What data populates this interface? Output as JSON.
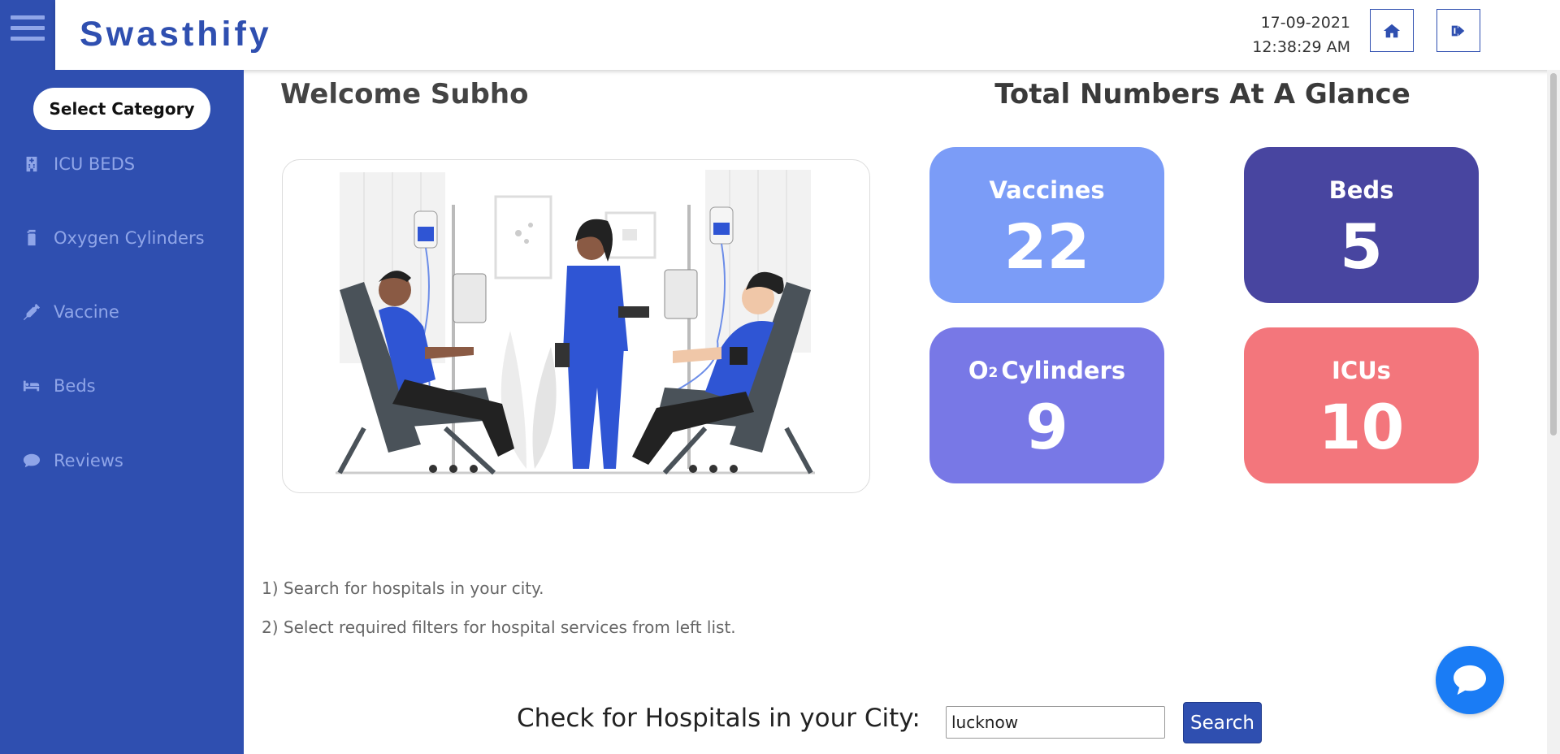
{
  "header": {
    "brand": "Swasthify",
    "date": "17-09-2021",
    "time": "12:38:29 AM",
    "home_icon": "home-icon",
    "logout_icon": "sign-out-icon"
  },
  "sidebar": {
    "category_button": "Select Category",
    "items": [
      {
        "label": "ICU BEDS",
        "icon": "hospital-building-icon"
      },
      {
        "label": "Oxygen Cylinders",
        "icon": "oxygen-cylinder-icon"
      },
      {
        "label": "Vaccine",
        "icon": "syringe-icon"
      },
      {
        "label": "Beds",
        "icon": "bed-icon"
      },
      {
        "label": "Reviews",
        "icon": "comment-icon"
      }
    ]
  },
  "main": {
    "welcome": "Welcome Subho",
    "glance_title": "Total Numbers At A Glance",
    "stats": [
      {
        "label": "Vaccines",
        "value": "22",
        "color": "#7b9cf7"
      },
      {
        "label": "Beds",
        "value": "5",
        "color": "#4845a0"
      },
      {
        "label_prefix": "O",
        "label_sub": "2",
        "label": "Cylinders",
        "value": "9",
        "color": "#7878e6"
      },
      {
        "label": "ICUs",
        "value": "10",
        "color": "#f3767c"
      }
    ],
    "steps": [
      "1) Search for hospitals in your city.",
      "2) Select required filters for hospital services from left list."
    ],
    "city_label": "Check for Hospitals in your City:",
    "city_value": "lucknow",
    "search_label": "Search"
  },
  "colors": {
    "primary": "#2f4fb0",
    "sidebar_text": "#8fa5e8",
    "chat": "#1a7cf5"
  }
}
